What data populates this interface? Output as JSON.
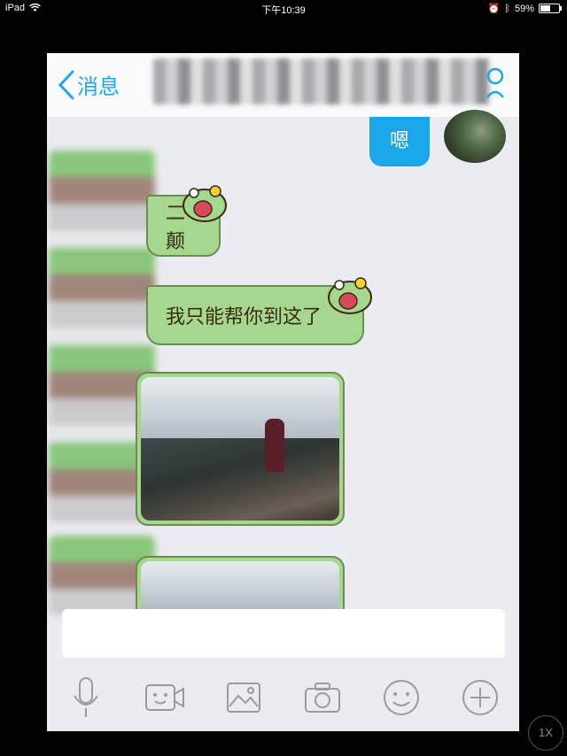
{
  "status_bar": {
    "device": "iPad",
    "time": "下午10:39",
    "battery": "59%",
    "battery_level": 0.59
  },
  "navbar": {
    "back_label": "消息"
  },
  "messages": {
    "sent_text": "嗯",
    "received": [
      {
        "text": "二颠"
      },
      {
        "text": "我只能帮你到这了"
      }
    ]
  },
  "input": {
    "placeholder": ""
  },
  "toolbar": {
    "icons": [
      "microphone-icon",
      "video-icon",
      "image-icon",
      "camera-icon",
      "emoji-icon",
      "plus-icon"
    ]
  },
  "overlay": {
    "zoom_label": "1X"
  },
  "colors": {
    "accent": "#1fa6e8",
    "bubble_green": "#a6d78f",
    "bubble_border": "#6b8c4e",
    "background": "#ebebf2"
  }
}
